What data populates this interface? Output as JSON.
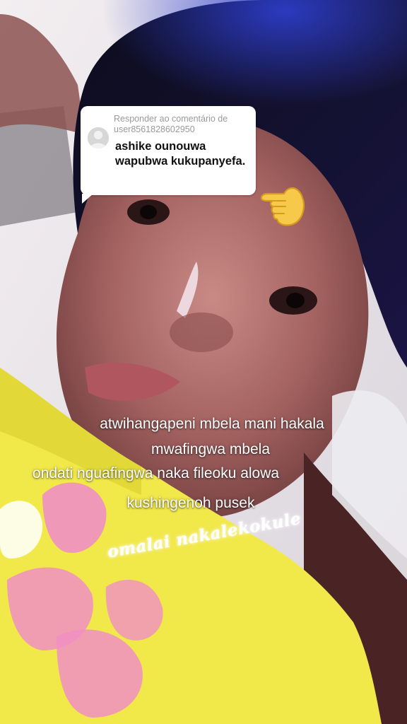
{
  "reply_card": {
    "label_prefix": "Responder ao comentário de",
    "username": "user8561828602950",
    "comment": "ashike ounouwa wapubwa kukupanyefa."
  },
  "emoji": {
    "name": "backhand-index-pointing-left-icon"
  },
  "captions": {
    "line1": "atwihangapeni mbela mani hakala",
    "line2": "mwafingwa mbela",
    "line3": "ondati nguafingwa naka fileoku alowa",
    "line4": "kushingenoh pusek"
  },
  "script_caption": "omalai nakalekokule",
  "colors": {
    "card_bg": "#ffffff",
    "meta_text": "#9a9a9a",
    "comment_text": "#111111",
    "caption_text": "#ffffff",
    "shirt_yellow": "#f1e84a",
    "print_pink": "#f08fc4"
  }
}
